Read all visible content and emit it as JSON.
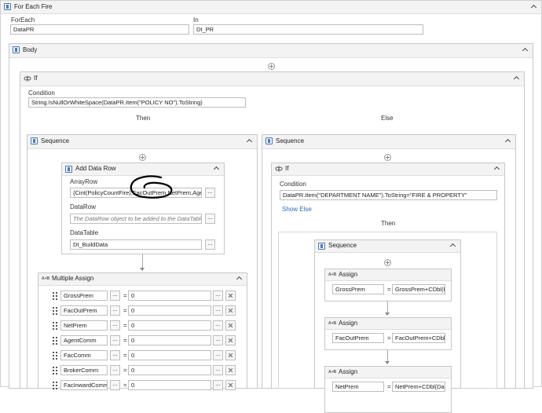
{
  "foreach": {
    "title": "For Each Fire",
    "foreach_label": "ForEach",
    "foreach_value": "DataPR",
    "in_label": "In",
    "in_value": "Dt_PR"
  },
  "body": {
    "title": "Body"
  },
  "if_outer": {
    "title": "If",
    "condition_label": "Condition",
    "condition_value": "String.IsNullOrWhiteSpace(DataPR.Item(\"POLICY NO\").ToString)",
    "then_label": "Then",
    "else_label": "Else"
  },
  "then_sequence": {
    "title": "Sequence",
    "add_data_row": {
      "title": "Add Data Row",
      "arrayrow_label": "ArrayRow",
      "arrayrow_value": "{Cint(PolicyCountFire),FacOutPrem,NetPrem,Agent",
      "datarow_label": "DataRow",
      "datarow_placeholder": "The DataRow object to be added to the DataTable.",
      "datatable_label": "DataTable",
      "datatable_value": "Dt_BuildData"
    },
    "multiple_assign": {
      "title": "Multiple Assign",
      "rows": [
        {
          "to": "GrossPrem",
          "value": "0"
        },
        {
          "to": "FacOutPrem",
          "value": "0"
        },
        {
          "to": "NetPrem",
          "value": "0"
        },
        {
          "to": "AgentComm",
          "value": "0"
        },
        {
          "to": "FacComm",
          "value": "0"
        },
        {
          "to": "BrokerComm",
          "value": "0"
        },
        {
          "to": "FacInwardComm",
          "value": "0"
        }
      ]
    }
  },
  "else_sequence": {
    "title": "Sequence",
    "if_inner": {
      "title": "If",
      "condition_label": "Condition",
      "condition_value": "DataPR.Item(\"DEPARTMENT NAME\").ToString=\"FIRE & PROPERTY\"",
      "show_else": "Show Else",
      "then_label": "Then",
      "sequence": {
        "title": "Sequence",
        "assigns": [
          {
            "title": "Assign",
            "to": "GrossPrem",
            "value": "GrossPrem+CDbl(D"
          },
          {
            "title": "Assign",
            "to": "FacOutPrem",
            "value": "FacOutPrem+CDbl"
          },
          {
            "title": "Assign",
            "to": "NetPrem",
            "value": "NetPrem+CDbl(Da"
          }
        ]
      }
    }
  },
  "glyphs": {
    "dots": "...",
    "equals": "="
  },
  "colors": {
    "accent": "#4a7ab8",
    "link": "#2b6cb8",
    "header": "#f3f3f3",
    "annotation": "#000000"
  }
}
